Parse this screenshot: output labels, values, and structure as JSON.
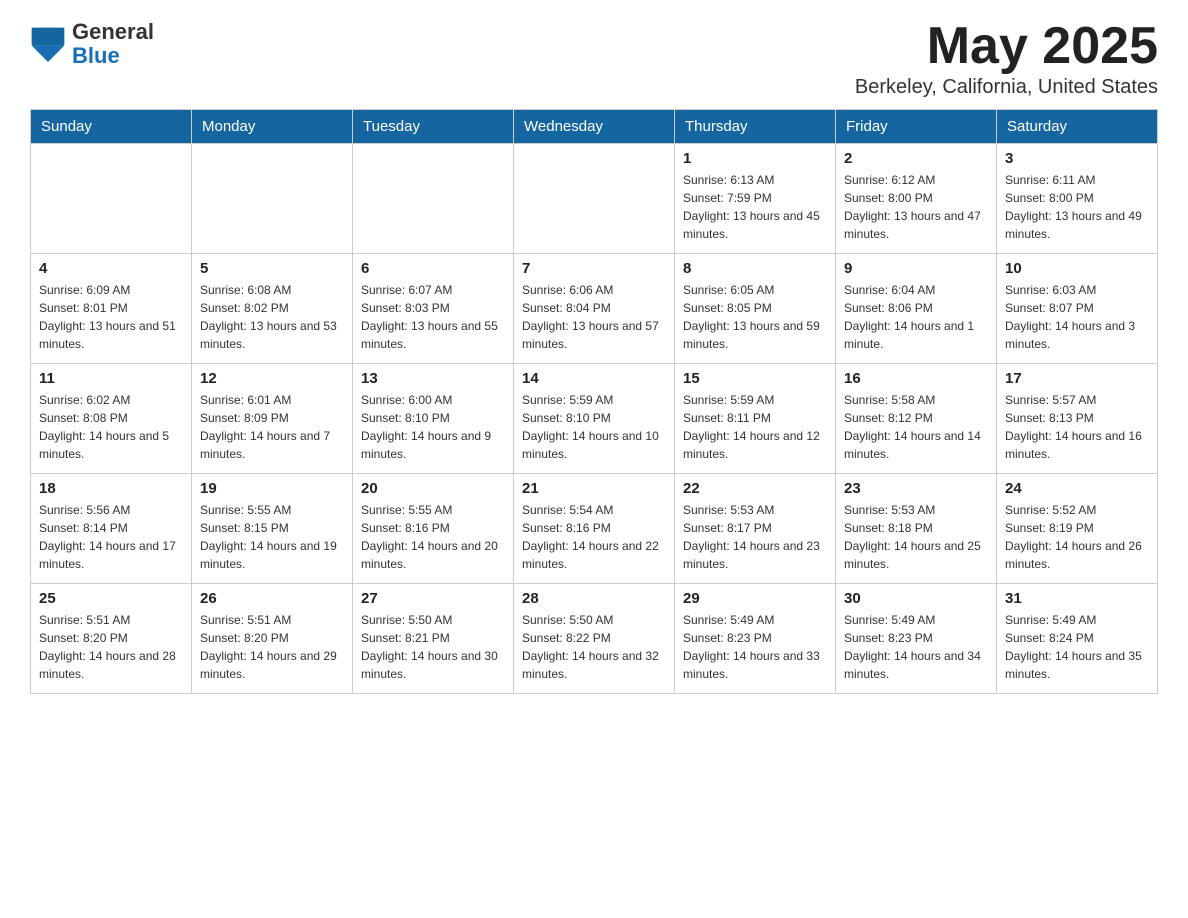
{
  "header": {
    "logo_general": "General",
    "logo_blue": "Blue",
    "month": "May 2025",
    "location": "Berkeley, California, United States"
  },
  "days_of_week": [
    "Sunday",
    "Monday",
    "Tuesday",
    "Wednesday",
    "Thursday",
    "Friday",
    "Saturday"
  ],
  "weeks": [
    [
      {
        "day": "",
        "sunrise": "",
        "sunset": "",
        "daylight": ""
      },
      {
        "day": "",
        "sunrise": "",
        "sunset": "",
        "daylight": ""
      },
      {
        "day": "",
        "sunrise": "",
        "sunset": "",
        "daylight": ""
      },
      {
        "day": "",
        "sunrise": "",
        "sunset": "",
        "daylight": ""
      },
      {
        "day": "1",
        "sunrise": "Sunrise: 6:13 AM",
        "sunset": "Sunset: 7:59 PM",
        "daylight": "Daylight: 13 hours and 45 minutes."
      },
      {
        "day": "2",
        "sunrise": "Sunrise: 6:12 AM",
        "sunset": "Sunset: 8:00 PM",
        "daylight": "Daylight: 13 hours and 47 minutes."
      },
      {
        "day": "3",
        "sunrise": "Sunrise: 6:11 AM",
        "sunset": "Sunset: 8:00 PM",
        "daylight": "Daylight: 13 hours and 49 minutes."
      }
    ],
    [
      {
        "day": "4",
        "sunrise": "Sunrise: 6:09 AM",
        "sunset": "Sunset: 8:01 PM",
        "daylight": "Daylight: 13 hours and 51 minutes."
      },
      {
        "day": "5",
        "sunrise": "Sunrise: 6:08 AM",
        "sunset": "Sunset: 8:02 PM",
        "daylight": "Daylight: 13 hours and 53 minutes."
      },
      {
        "day": "6",
        "sunrise": "Sunrise: 6:07 AM",
        "sunset": "Sunset: 8:03 PM",
        "daylight": "Daylight: 13 hours and 55 minutes."
      },
      {
        "day": "7",
        "sunrise": "Sunrise: 6:06 AM",
        "sunset": "Sunset: 8:04 PM",
        "daylight": "Daylight: 13 hours and 57 minutes."
      },
      {
        "day": "8",
        "sunrise": "Sunrise: 6:05 AM",
        "sunset": "Sunset: 8:05 PM",
        "daylight": "Daylight: 13 hours and 59 minutes."
      },
      {
        "day": "9",
        "sunrise": "Sunrise: 6:04 AM",
        "sunset": "Sunset: 8:06 PM",
        "daylight": "Daylight: 14 hours and 1 minute."
      },
      {
        "day": "10",
        "sunrise": "Sunrise: 6:03 AM",
        "sunset": "Sunset: 8:07 PM",
        "daylight": "Daylight: 14 hours and 3 minutes."
      }
    ],
    [
      {
        "day": "11",
        "sunrise": "Sunrise: 6:02 AM",
        "sunset": "Sunset: 8:08 PM",
        "daylight": "Daylight: 14 hours and 5 minutes."
      },
      {
        "day": "12",
        "sunrise": "Sunrise: 6:01 AM",
        "sunset": "Sunset: 8:09 PM",
        "daylight": "Daylight: 14 hours and 7 minutes."
      },
      {
        "day": "13",
        "sunrise": "Sunrise: 6:00 AM",
        "sunset": "Sunset: 8:10 PM",
        "daylight": "Daylight: 14 hours and 9 minutes."
      },
      {
        "day": "14",
        "sunrise": "Sunrise: 5:59 AM",
        "sunset": "Sunset: 8:10 PM",
        "daylight": "Daylight: 14 hours and 10 minutes."
      },
      {
        "day": "15",
        "sunrise": "Sunrise: 5:59 AM",
        "sunset": "Sunset: 8:11 PM",
        "daylight": "Daylight: 14 hours and 12 minutes."
      },
      {
        "day": "16",
        "sunrise": "Sunrise: 5:58 AM",
        "sunset": "Sunset: 8:12 PM",
        "daylight": "Daylight: 14 hours and 14 minutes."
      },
      {
        "day": "17",
        "sunrise": "Sunrise: 5:57 AM",
        "sunset": "Sunset: 8:13 PM",
        "daylight": "Daylight: 14 hours and 16 minutes."
      }
    ],
    [
      {
        "day": "18",
        "sunrise": "Sunrise: 5:56 AM",
        "sunset": "Sunset: 8:14 PM",
        "daylight": "Daylight: 14 hours and 17 minutes."
      },
      {
        "day": "19",
        "sunrise": "Sunrise: 5:55 AM",
        "sunset": "Sunset: 8:15 PM",
        "daylight": "Daylight: 14 hours and 19 minutes."
      },
      {
        "day": "20",
        "sunrise": "Sunrise: 5:55 AM",
        "sunset": "Sunset: 8:16 PM",
        "daylight": "Daylight: 14 hours and 20 minutes."
      },
      {
        "day": "21",
        "sunrise": "Sunrise: 5:54 AM",
        "sunset": "Sunset: 8:16 PM",
        "daylight": "Daylight: 14 hours and 22 minutes."
      },
      {
        "day": "22",
        "sunrise": "Sunrise: 5:53 AM",
        "sunset": "Sunset: 8:17 PM",
        "daylight": "Daylight: 14 hours and 23 minutes."
      },
      {
        "day": "23",
        "sunrise": "Sunrise: 5:53 AM",
        "sunset": "Sunset: 8:18 PM",
        "daylight": "Daylight: 14 hours and 25 minutes."
      },
      {
        "day": "24",
        "sunrise": "Sunrise: 5:52 AM",
        "sunset": "Sunset: 8:19 PM",
        "daylight": "Daylight: 14 hours and 26 minutes."
      }
    ],
    [
      {
        "day": "25",
        "sunrise": "Sunrise: 5:51 AM",
        "sunset": "Sunset: 8:20 PM",
        "daylight": "Daylight: 14 hours and 28 minutes."
      },
      {
        "day": "26",
        "sunrise": "Sunrise: 5:51 AM",
        "sunset": "Sunset: 8:20 PM",
        "daylight": "Daylight: 14 hours and 29 minutes."
      },
      {
        "day": "27",
        "sunrise": "Sunrise: 5:50 AM",
        "sunset": "Sunset: 8:21 PM",
        "daylight": "Daylight: 14 hours and 30 minutes."
      },
      {
        "day": "28",
        "sunrise": "Sunrise: 5:50 AM",
        "sunset": "Sunset: 8:22 PM",
        "daylight": "Daylight: 14 hours and 32 minutes."
      },
      {
        "day": "29",
        "sunrise": "Sunrise: 5:49 AM",
        "sunset": "Sunset: 8:23 PM",
        "daylight": "Daylight: 14 hours and 33 minutes."
      },
      {
        "day": "30",
        "sunrise": "Sunrise: 5:49 AM",
        "sunset": "Sunset: 8:23 PM",
        "daylight": "Daylight: 14 hours and 34 minutes."
      },
      {
        "day": "31",
        "sunrise": "Sunrise: 5:49 AM",
        "sunset": "Sunset: 8:24 PM",
        "daylight": "Daylight: 14 hours and 35 minutes."
      }
    ]
  ]
}
